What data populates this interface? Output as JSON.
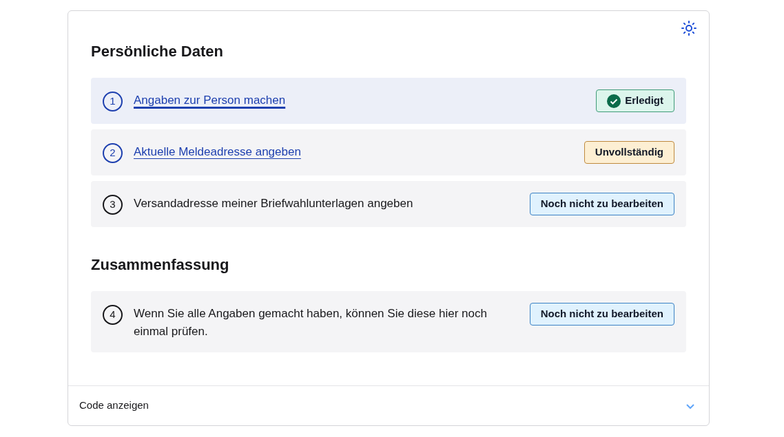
{
  "sections": [
    {
      "title": "Persönliche Daten",
      "steps": [
        {
          "number": "1",
          "text": "Angaben zur Person machen",
          "kind": "link",
          "selected": true,
          "status": {
            "kind": "done",
            "label": "Erledigt"
          }
        },
        {
          "number": "2",
          "text": "Aktuelle Meldeadresse angeben",
          "kind": "link",
          "selected": false,
          "status": {
            "kind": "incomplete",
            "label": "Unvollständig"
          }
        },
        {
          "number": "3",
          "text": "Versandadresse meiner Briefwahlunterlagen angeben",
          "kind": "text",
          "selected": false,
          "status": {
            "kind": "pending",
            "label": "Noch nicht zu bearbeiten"
          }
        }
      ]
    },
    {
      "title": "Zusammenfassung",
      "steps": [
        {
          "number": "4",
          "text": "Wenn Sie alle Angaben gemacht haben, können Sie diese hier noch einmal prüfen.",
          "kind": "text",
          "selected": false,
          "status": {
            "kind": "pending",
            "label": "Noch nicht zu bearbeiten"
          }
        }
      ]
    }
  ],
  "footer": {
    "label": "Code anzeigen",
    "expanded": false
  }
}
